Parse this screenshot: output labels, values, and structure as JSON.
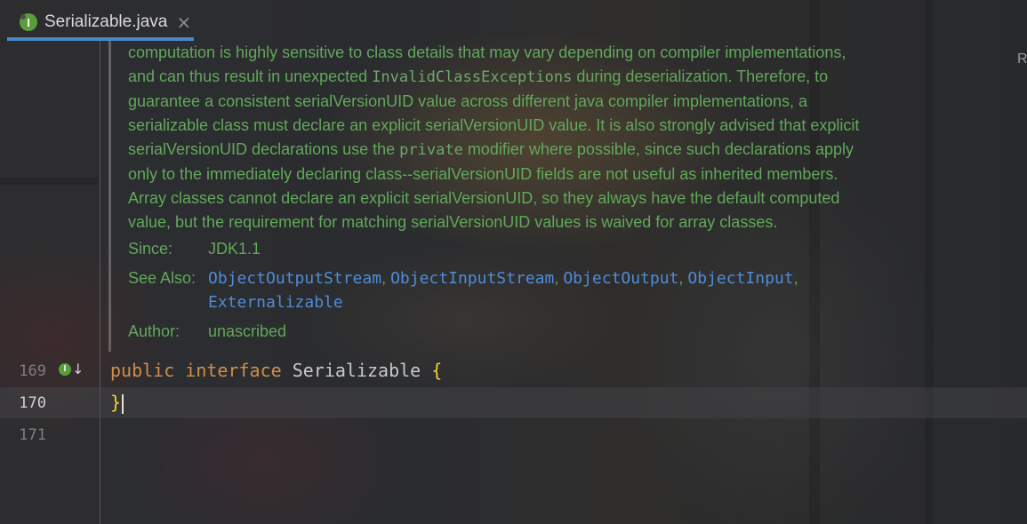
{
  "tab": {
    "icon_letter": "I",
    "label": "Serializable.java",
    "close": "×"
  },
  "right_edge_label": "R",
  "doc": {
    "lines": [
      {
        "t": "computation is highly sensitive to class details that may vary depending on compiler implementations,"
      },
      {
        "pre": "and can thus result in unexpected ",
        "code": "InvalidClassExceptions",
        "post": " during deserialization. Therefore, to"
      },
      {
        "t": "guarantee a consistent serialVersionUID value across different java compiler implementations, a"
      },
      {
        "t": "serializable class must declare an explicit serialVersionUID value. It is also strongly advised that explicit"
      },
      {
        "pre": "serialVersionUID declarations use the ",
        "code": "private",
        "post": " modifier where possible, since such declarations apply"
      },
      {
        "t": "only to the immediately declaring class--serialVersionUID fields are not useful as inherited members."
      },
      {
        "t": "Array classes cannot declare an explicit serialVersionUID, so they always have the default computed"
      },
      {
        "t": "value, but the requirement for matching serialVersionUID values is waived for array classes."
      }
    ],
    "since_label": "Since:",
    "since_value": "JDK1.1",
    "see_also_label": "See Also:",
    "see_also": [
      "ObjectOutputStream",
      "ObjectInputStream",
      "ObjectOutput",
      "ObjectInput",
      "Externalizable"
    ],
    "author_label": "Author:",
    "author_value": "unascribed"
  },
  "code": {
    "line_numbers": [
      "169",
      "170",
      "171"
    ],
    "line169": {
      "kw1": "public",
      "kw2": "interface",
      "name": "Serializable",
      "brace": "{"
    },
    "line170": {
      "brace": "}"
    },
    "gutter_icon_letter": "I",
    "gutter_arrow": "↓"
  },
  "colors": {
    "doc_text": "#61a85a",
    "link": "#4f8cd6",
    "keyword": "#cf8e4a",
    "brace": "#f2d12e",
    "tab_underline": "#4a88c7"
  }
}
